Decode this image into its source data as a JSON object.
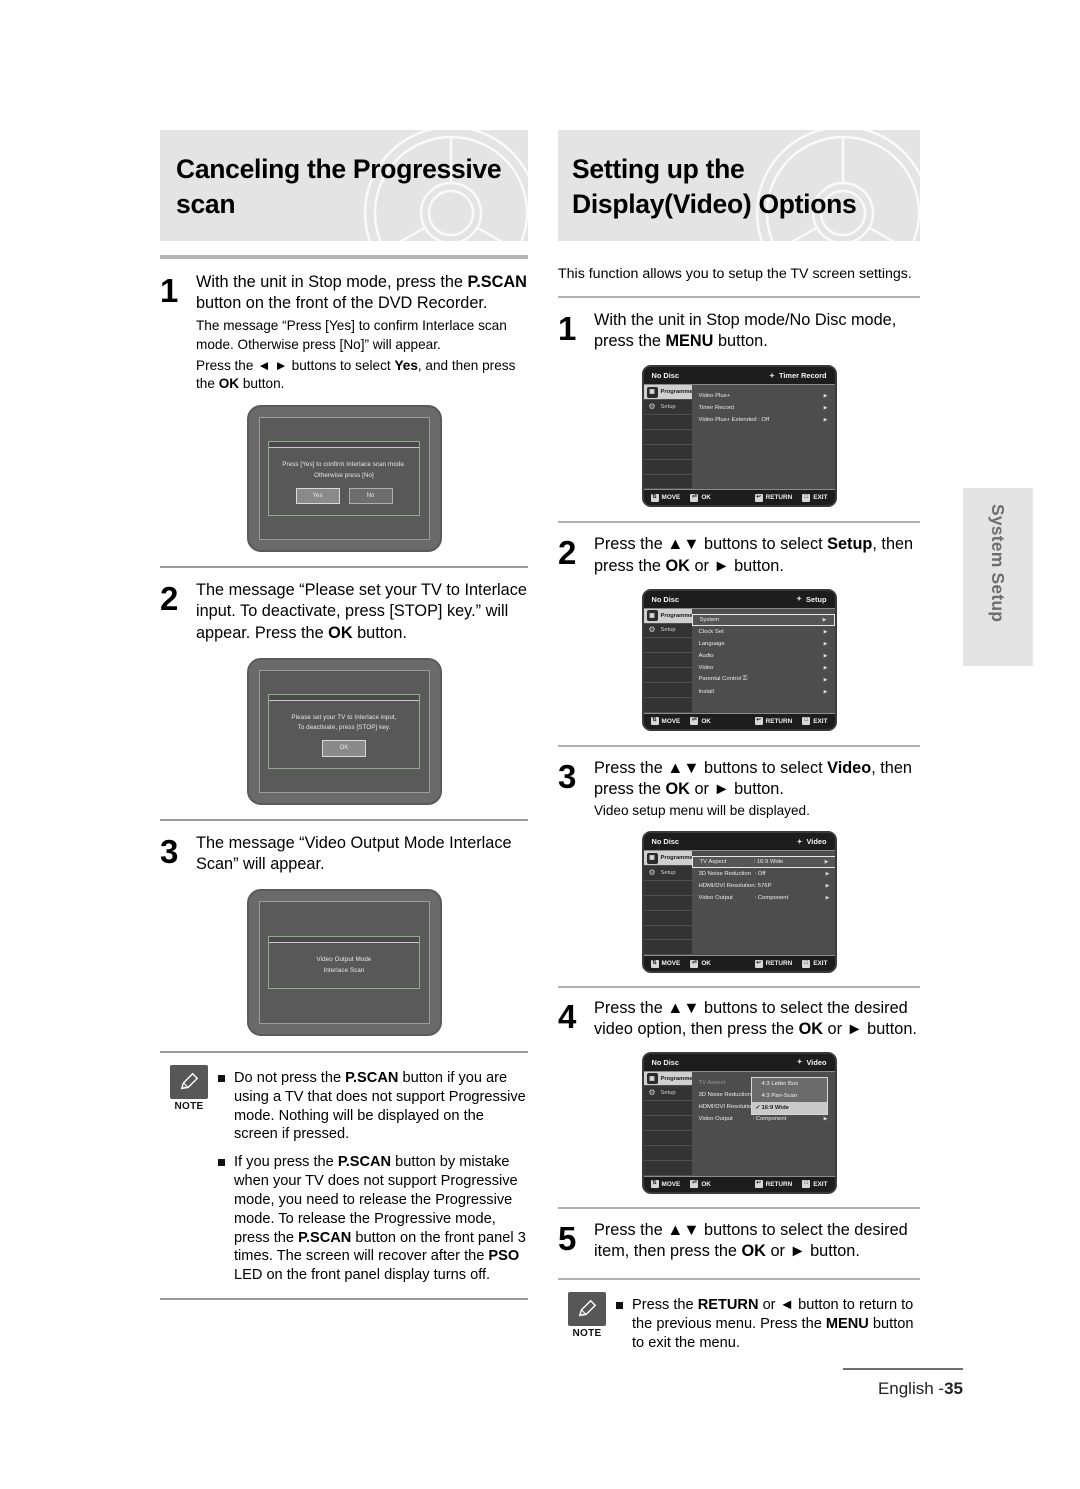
{
  "left": {
    "title": "Canceling the Progressive scan",
    "steps": [
      {
        "num": "1",
        "main_a": "With the unit in Stop mode, press the ",
        "main_b": "P.SCAN",
        "main_c": " button on the front of the DVD Recorder.",
        "sub_1": "The message “Press [Yes] to confirm Interlace scan mode. Otherwise press [No]” will appear.",
        "sub_2a": "Press the ◄ ► buttons to select ",
        "sub_2b": "Yes",
        "sub_2c": ", and then press the ",
        "sub_2d": "OK",
        "sub_2e": " button."
      },
      {
        "num": "2",
        "main_a": "The message “Please set your TV to Interlace input. To deactivate, press [STOP] key.” will appear. Press the ",
        "main_b": "OK",
        "main_c": " button."
      },
      {
        "num": "3",
        "main_a": "The message “Video Output Mode Interlace Scan” will appear."
      }
    ],
    "tv_screens": [
      {
        "line1": "Press [Yes] to confirm Interlace scan mode.",
        "line2": "Otherwise press [No]",
        "buttons": [
          "Yes",
          "No"
        ],
        "selected": "Yes"
      },
      {
        "line1": "Please set your TV to Interlace input,",
        "line2": "To deactivate, press [STOP] key.",
        "buttons": [
          "OK"
        ],
        "selected": "OK"
      },
      {
        "line1": "Video Output Mode",
        "line2": "Interlace Scan",
        "buttons": [],
        "selected": ""
      }
    ],
    "note": {
      "label": "NOTE",
      "items": [
        {
          "a": "Do not press the ",
          "b": "P.SCAN",
          "c": " button if you are using a TV that does not support Progressive mode. Nothing will be displayed on the screen if pressed."
        },
        {
          "a": "If you press the ",
          "b": "P.SCAN",
          "c": " button by mistake when your TV does not support Progressive mode, you need to release the Progressive mode. To release the Progressive mode, press the ",
          "d": "P.SCAN",
          "e": " button on the front panel 3 times. The screen will recover after the ",
          "f": "PSO",
          "g": " LED on the front panel display turns off."
        }
      ]
    }
  },
  "right": {
    "title_line1": "Setting up the",
    "title_line2": "Display(Video) Options",
    "intro": "This function allows you to setup the TV screen settings.",
    "steps": [
      {
        "num": "1",
        "a": "With the unit in Stop mode/No Disc mode, press the ",
        "b": "MENU",
        "c": " button."
      },
      {
        "num": "2",
        "a": "Press the ▲▼ buttons to select ",
        "b": "Setup",
        "c": ", then press the ",
        "d": "OK",
        "e": " or ► button."
      },
      {
        "num": "3",
        "a": "Press the ▲▼ buttons to select ",
        "b": "Video",
        "c": ", then press the ",
        "d": "OK",
        "e": " or ► button.",
        "sub": "Video setup menu will be displayed."
      },
      {
        "num": "4",
        "a": "Press the ▲▼ buttons to select the desired video option, then press the ",
        "b": "OK",
        "c": " or ► button."
      },
      {
        "num": "5",
        "a": "Press the ▲▼ buttons to select the desired item, then press the ",
        "b": "OK",
        "c": " or ► button."
      }
    ],
    "note": {
      "label": "NOTE",
      "item": {
        "a": "Press the ",
        "b": "RETURN",
        "c": " or ◄ button to return to the previous menu. Press the ",
        "d": "MENU",
        "e": " button to exit the menu."
      }
    },
    "osd_screens": [
      {
        "disc_status": "No Disc",
        "header": "Timer Record",
        "side": [
          {
            "label": "Programme",
            "icon": "programme-icon",
            "active": true
          },
          {
            "label": "Setup",
            "icon": "gear-icon",
            "active": false
          }
        ],
        "rows": [
          {
            "label": "Video Plus+",
            "value": "",
            "arrow": true,
            "highlight": false
          },
          {
            "label": "Timer Record",
            "value": "",
            "arrow": true,
            "highlight": false
          },
          {
            "label": "Video Plus+ Extended : Off",
            "value": "",
            "arrow": true,
            "highlight": false
          }
        ],
        "popup": null,
        "footer": [
          "MOVE",
          "OK",
          "RETURN",
          "EXIT"
        ]
      },
      {
        "disc_status": "No Disc",
        "header": "Setup",
        "side": [
          {
            "label": "Programme",
            "icon": "programme-icon",
            "active": true
          },
          {
            "label": "Setup",
            "icon": "gear-icon",
            "active": false
          }
        ],
        "rows": [
          {
            "label": "System",
            "value": "",
            "arrow": true,
            "highlight": true
          },
          {
            "label": "Clock Set",
            "value": "",
            "arrow": true,
            "highlight": false
          },
          {
            "label": "Language",
            "value": "",
            "arrow": true,
            "highlight": false
          },
          {
            "label": "Audio",
            "value": "",
            "arrow": true,
            "highlight": false
          },
          {
            "label": "Video",
            "value": "",
            "arrow": true,
            "highlight": false
          },
          {
            "label": "Parental Control ⚿",
            "value": "",
            "arrow": true,
            "highlight": false
          },
          {
            "label": "Install",
            "value": "",
            "arrow": true,
            "highlight": false
          }
        ],
        "popup": null,
        "footer": [
          "MOVE",
          "OK",
          "RETURN",
          "EXIT"
        ]
      },
      {
        "disc_status": "No Disc",
        "header": "Video",
        "side": [
          {
            "label": "Programme",
            "icon": "programme-icon",
            "active": true
          },
          {
            "label": "Setup",
            "icon": "gear-icon",
            "active": false
          }
        ],
        "rows": [
          {
            "label": "TV Aspect",
            "value": ": 16:9 Wide",
            "arrow": true,
            "highlight": true
          },
          {
            "label": "3D Noise Reduction",
            "value": ": Off",
            "arrow": true,
            "highlight": false
          },
          {
            "label": "HDMI/DVI Resolution",
            "value": ": 576P",
            "arrow": true,
            "highlight": false
          },
          {
            "label": "Video Output",
            "value": ": Component",
            "arrow": true,
            "highlight": false
          }
        ],
        "popup": null,
        "footer": [
          "MOVE",
          "OK",
          "RETURN",
          "EXIT"
        ]
      },
      {
        "disc_status": "No Disc",
        "header": "Video",
        "side": [
          {
            "label": "Programme",
            "icon": "programme-icon",
            "active": true
          },
          {
            "label": "Setup",
            "icon": "gear-icon",
            "active": false
          }
        ],
        "rows": [
          {
            "label": "TV Aspect",
            "value": "",
            "arrow": false,
            "highlight": false,
            "dim": true
          },
          {
            "label": "3D Noise Reduction",
            "value": "",
            "arrow": false,
            "highlight": false,
            "dim": false
          },
          {
            "label": "HDMI/DVI Resolution",
            "value": "",
            "arrow": false,
            "highlight": false,
            "dim": false
          },
          {
            "label": "Video Output",
            "value": ": Component",
            "arrow": true,
            "highlight": false,
            "dim": false
          }
        ],
        "popup": {
          "options": [
            "4:3 Letter Box",
            "4:3 Pan-Scan",
            "16:9 Wide"
          ],
          "selected": "16:9 Wide",
          "check": "✓"
        },
        "footer": [
          "MOVE",
          "OK",
          "RETURN",
          "EXIT"
        ]
      }
    ]
  },
  "side_tab": "System Setup",
  "footer": {
    "lang": "English -",
    "page": "35"
  }
}
